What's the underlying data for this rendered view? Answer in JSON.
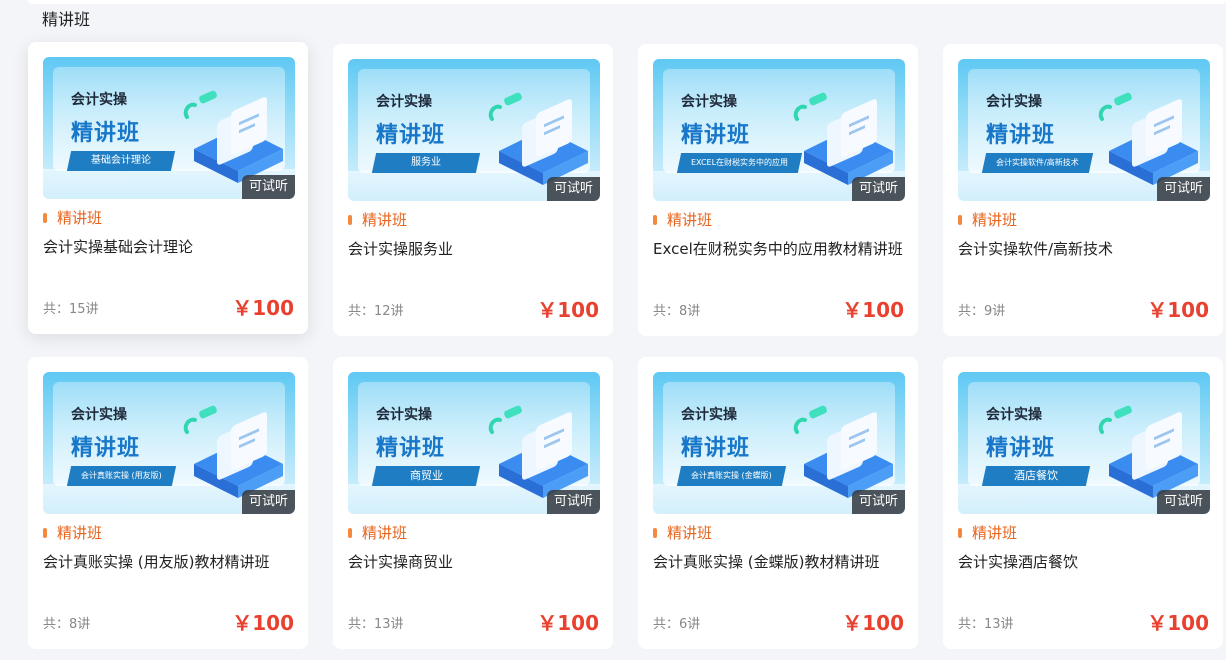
{
  "section": {
    "title": "精讲班"
  },
  "thumb": {
    "line1": "会计实操",
    "line2": "精讲班",
    "trial_label": "可试听"
  },
  "cards": [
    {
      "banner": "基础会计理论",
      "tag": "精讲班",
      "title": "会计实操基础会计理论",
      "count": "共：15讲",
      "price": "￥100"
    },
    {
      "banner": "服务业",
      "tag": "精讲班",
      "title": "会计实操服务业",
      "count": "共：12讲",
      "price": "￥100"
    },
    {
      "banner": "EXCEL在财税实务中的应用",
      "tag": "精讲班",
      "title": "Excel在财税实务中的应用教材精讲班",
      "count": "共：8讲",
      "price": "￥100"
    },
    {
      "banner": "会计实操软件/高新技术",
      "tag": "精讲班",
      "title": "会计实操软件/高新技术",
      "count": "共：9讲",
      "price": "￥100"
    },
    {
      "banner": "会计真账实操 (用友版)",
      "tag": "精讲班",
      "title": "会计真账实操 (用友版)教材精讲班",
      "count": "共：8讲",
      "price": "￥100"
    },
    {
      "banner": "商贸业",
      "tag": "精讲班",
      "title": "会计实操商贸业",
      "count": "共：13讲",
      "price": "￥100"
    },
    {
      "banner": "会计真账实操 (金蝶版)",
      "tag": "精讲班",
      "title": "会计真账实操 (金蝶版)教材精讲班",
      "count": "共：6讲",
      "price": "￥100"
    },
    {
      "banner": "酒店餐饮",
      "tag": "精讲班",
      "title": "会计实操酒店餐饮",
      "count": "共：13讲",
      "price": "￥100"
    }
  ],
  "colors": {
    "accent": "#e8641c",
    "price": "#e8412f",
    "banner": "#1f7ec3"
  },
  "icons": {
    "illustration": "stacked-documents-icon"
  }
}
